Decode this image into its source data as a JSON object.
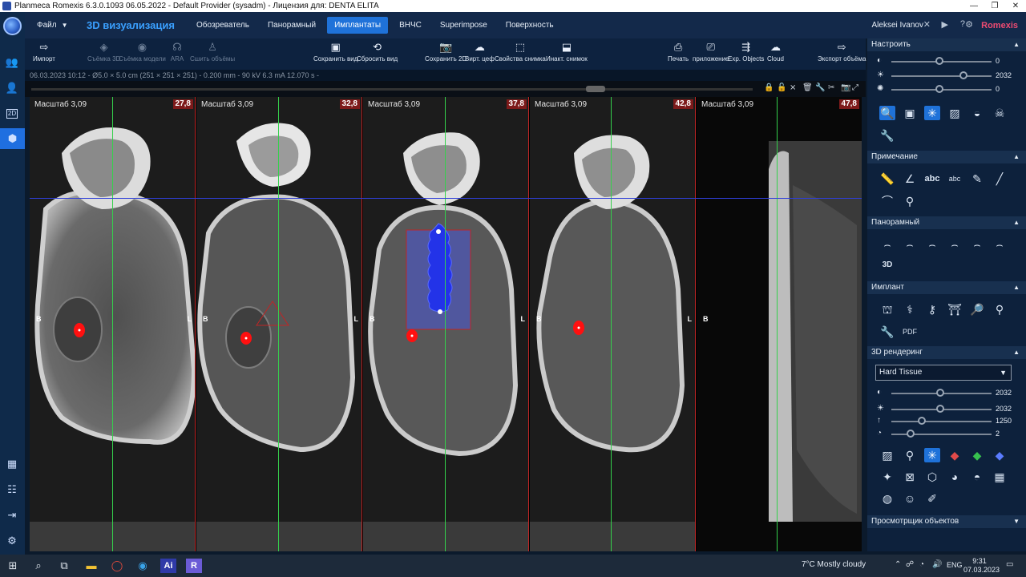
{
  "window": {
    "title": "Planmeca Romexis 6.3.0.1093 06.05.2022 - Default Provider (sysadm) - Лицензия для: DENTA ELITA",
    "controls": [
      "—",
      "❐",
      "✕"
    ]
  },
  "nav": {
    "file_label": "Файл",
    "section_title": "3D визуализация",
    "tabs": [
      "Обозреватель",
      "Панорамный",
      "Имплантаты",
      "ВНЧС",
      "Superimpose",
      "Поверхность"
    ],
    "active_tab": "Имплантаты",
    "user": "Aleksei Ivanov",
    "brand": "Romexis"
  },
  "toolbar": {
    "import": "Импорт",
    "capture_3d": "Съёмка 3D",
    "capture_model": "Съёмка модели",
    "ara": "ARA",
    "stitch": "Сшить объёмы",
    "save_view": "Сохранить вид",
    "reset_view": "Сбросить вид",
    "save_2d": "Сохранить 2D",
    "virt_ceph": "Вирт. цеф",
    "image_props": "Свойства снимка",
    "inactive_image": "Инакт. снимок",
    "print": "Печать",
    "app": "приложение",
    "exp_objects": "Exp. Objects",
    "cloud": "Cloud",
    "export_volume": "Экспорт объёма"
  },
  "info_line": "06.03.2023 10:12 - Ø5.0 × 5.0 cm (251 × 251 × 251) - 0.200 mm - 90 kV 6.3 mA 12.070 s -",
  "viewer": {
    "panes": [
      {
        "scale": "Масштаб 3,09",
        "badge": "27,8",
        "b": "B",
        "l": "L"
      },
      {
        "scale": "Масштаб 3,09",
        "badge": "32,8",
        "b": "B",
        "l": "L"
      },
      {
        "scale": "Масштаб 3,09",
        "badge": "37,8",
        "b": "B",
        "l": "L"
      },
      {
        "scale": "Масштаб 3,09",
        "badge": "42,8",
        "b": "B",
        "l": "L"
      },
      {
        "scale": "Масштаб 3,09",
        "badge": "47,8",
        "b": "B",
        "l": ""
      }
    ]
  },
  "right_panel": {
    "adjust": {
      "title": "Настроить",
      "sliders": [
        {
          "icon": "contrast-icon",
          "value": "0",
          "level": 0.5
        },
        {
          "icon": "brightness-icon",
          "value": "2032",
          "level": 0.75
        },
        {
          "icon": "gamma-icon",
          "value": "0",
          "level": 0.5
        }
      ]
    },
    "notes_title": "Примечание",
    "panoramic_title": "Панорамный",
    "implant_title": "Имплант",
    "rendering": {
      "title": "3D рендеринг",
      "preset": "Hard Tissue",
      "sliders": [
        {
          "icon": "contrast-icon",
          "value": "2032",
          "level": 0.5
        },
        {
          "icon": "brightness-icon",
          "value": "2032",
          "level": 0.5
        },
        {
          "icon": "arrow-up-icon",
          "value": "1250",
          "level": 0.32
        },
        {
          "icon": "opacity-icon",
          "value": "2",
          "level": 0.2
        }
      ]
    },
    "object_viewer_title": "Просмотрщик объектов"
  },
  "taskbar": {
    "weather": "7°C  Mostly cloudy",
    "lang": "ENG",
    "time": "9:31",
    "date": "07.03.2023"
  }
}
